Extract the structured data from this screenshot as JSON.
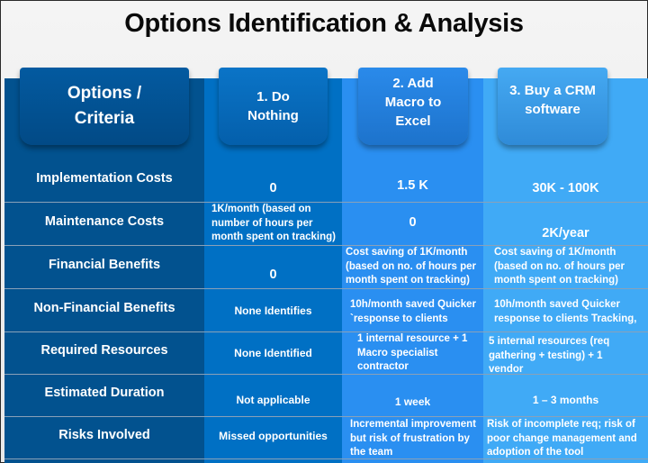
{
  "title": "Options Identification & Analysis",
  "colors": {
    "criteria_column": "#02528f",
    "option1_column": "#0070c4",
    "option2_column": "#2a8ff1",
    "option3_column": "#40aaf6",
    "text": "#ffffff",
    "title_text": "#0a0a0a"
  },
  "headers": {
    "criteria": "Options /\nCriteria",
    "option1": "1. Do\nNothing",
    "option2": "2. Add\nMacro to\nExcel",
    "option3": "3. Buy a CRM\nsoftware"
  },
  "rows": [
    {
      "criterion": "Implementation Costs",
      "option1": "0",
      "option2": "1.5 K",
      "option3": "30K - 100K"
    },
    {
      "criterion": "Maintenance Costs",
      "option1": "1K/month  (based on\nnumber of hours per\nmonth spent on tracking)",
      "option2": "0",
      "option3": "2K/year"
    },
    {
      "criterion": "Financial Benefits",
      "option1": "0",
      "option2": "Cost saving of 1K/month\n(based on no. of hours per\nmonth spent on tracking)",
      "option3": "Cost saving of 1K/month\n(based on no. of hours per\nmonth spent on tracking)"
    },
    {
      "criterion": "Non-Financial Benefits",
      "option1": "None Identifies",
      "option2": "10h/month  saved Quicker\n`response to clients",
      "option3": "10h/month  saved Quicker\nresponse to clients Tracking,"
    },
    {
      "criterion": "Required Resources",
      "option1": "None Identified",
      "option2": "1 internal resource + 1\nMacro specialist\ncontractor",
      "option3": "5 internal resources (req\ngathering + testing) + 1\nvendor"
    },
    {
      "criterion": "Estimated Duration",
      "option1": "Not applicable",
      "option2": "1 week",
      "option3": "1 – 3 months"
    },
    {
      "criterion": "Risks Involved",
      "option1": "Missed opportunities",
      "option2": "Incremental improvement\nbut risk of frustration by\nthe team",
      "option3": "Risk of incomplete req; risk of\npoor change management and\nadoption of the tool"
    }
  ]
}
